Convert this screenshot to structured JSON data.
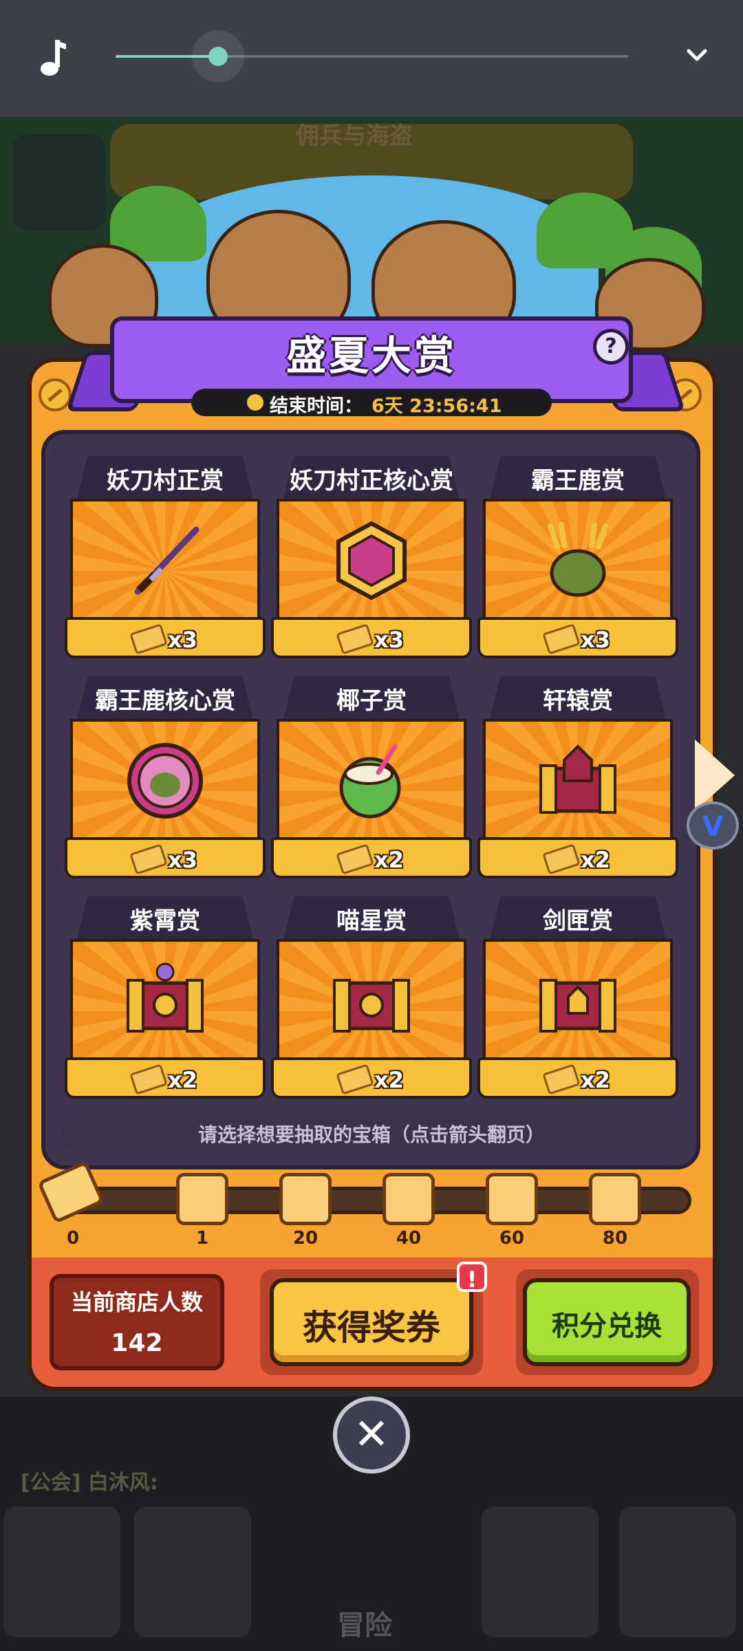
{
  "media_bar": {
    "progress": 0.2,
    "icons": [
      "music-note-icon",
      "chevron-down-icon"
    ]
  },
  "background": {
    "chat_text": "[公会] 白沐风:",
    "nav_adventure": "冒险",
    "header_text": "佣兵与海盗"
  },
  "panel": {
    "title": "盛夏大赏",
    "timer_label": "结束时间：",
    "timer_value": "6天 23:56:41"
  },
  "chests": [
    {
      "name": "妖刀村正赏",
      "cost": "x3",
      "icon": "katana-icon"
    },
    {
      "name": "妖刀村正核心赏",
      "cost": "x3",
      "icon": "katana-core-icon"
    },
    {
      "name": "霸王鹿赏",
      "cost": "x3",
      "icon": "deer-king-icon"
    },
    {
      "name": "霸王鹿核心赏",
      "cost": "x3",
      "icon": "deer-core-icon"
    },
    {
      "name": "椰子赏",
      "cost": "x2",
      "icon": "coconut-icon"
    },
    {
      "name": "轩辕赏",
      "cost": "x2",
      "icon": "xuanyuan-chest-icon"
    },
    {
      "name": "紫霄赏",
      "cost": "x2",
      "icon": "purple-chest-icon"
    },
    {
      "name": "喵星赏",
      "cost": "x2",
      "icon": "cat-star-chest-icon"
    },
    {
      "name": "剑匣赏",
      "cost": "x2",
      "icon": "sword-chest-icon"
    }
  ],
  "hint": "请选择想要抽取的宝箱（点击箭头翻页）",
  "progress": {
    "start_label": "0",
    "nodes": [
      {
        "label": "1",
        "icon": "purple-wand-icon"
      },
      {
        "label": "20",
        "icon": "ticket-icon"
      },
      {
        "label": "40",
        "icon": "scroll-icon"
      },
      {
        "label": "60",
        "icon": "purple-wand-icon"
      },
      {
        "label": "80",
        "icon": "ticket-icon"
      }
    ]
  },
  "shop": {
    "label": "当前商店人数",
    "count": "142"
  },
  "buttons": {
    "get_voucher": "获得奖券",
    "alert": "!",
    "exchange": "积分兑换"
  },
  "colors": {
    "panel": "#f6a530",
    "banner": "#9d5df2",
    "accent_green": "#a9e138",
    "accent_yellow": "#f8c545",
    "slider": "#7fd3c3"
  }
}
